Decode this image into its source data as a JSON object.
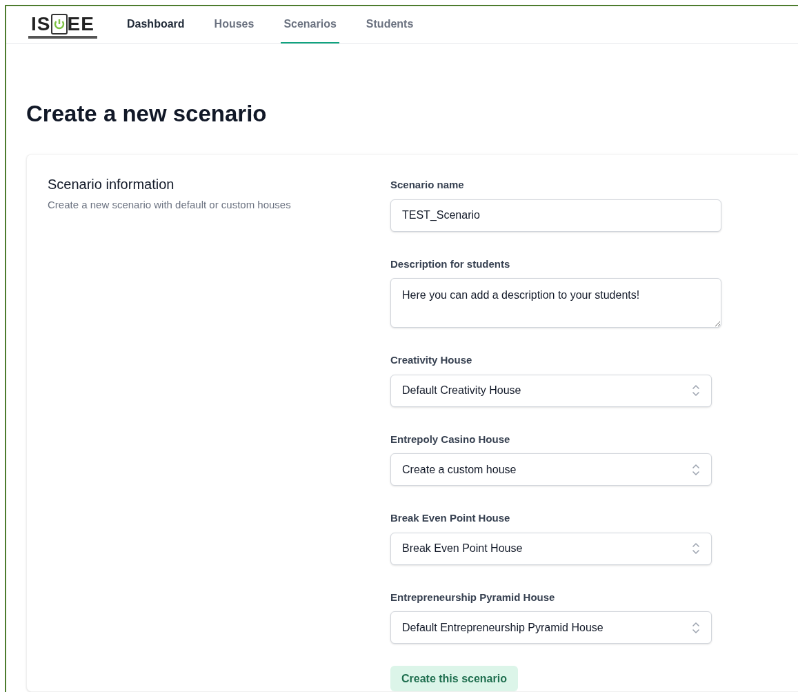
{
  "logo": {
    "left": "IS",
    "right": "EE"
  },
  "nav": [
    {
      "label": "Dashboard",
      "selected": false,
      "highlighted": true
    },
    {
      "label": "Houses",
      "selected": false,
      "highlighted": false
    },
    {
      "label": "Scenarios",
      "selected": true,
      "highlighted": false
    },
    {
      "label": "Students",
      "selected": false,
      "highlighted": false
    }
  ],
  "page_title": "Create a new scenario",
  "section": {
    "title": "Scenario information",
    "description": "Create a new scenario with default or custom houses"
  },
  "fields": [
    {
      "kind": "text",
      "label": "Scenario name",
      "value": "TEST_Scenario"
    },
    {
      "kind": "textarea",
      "label": "Description for students",
      "value": "Here you can add a description to your students!"
    },
    {
      "kind": "select",
      "label": "Creativity House",
      "value": "Default Creativity House"
    },
    {
      "kind": "select",
      "label": "Entrepoly Casino House",
      "value": "Create a custom house"
    },
    {
      "kind": "select",
      "label": "Break Even Point House",
      "value": "Break Even Point House"
    },
    {
      "kind": "select",
      "label": "Entrepreneurship Pyramid House",
      "value": "Default Entrepreneurship Pyramid House"
    }
  ],
  "submit_button": "Create this scenario"
}
